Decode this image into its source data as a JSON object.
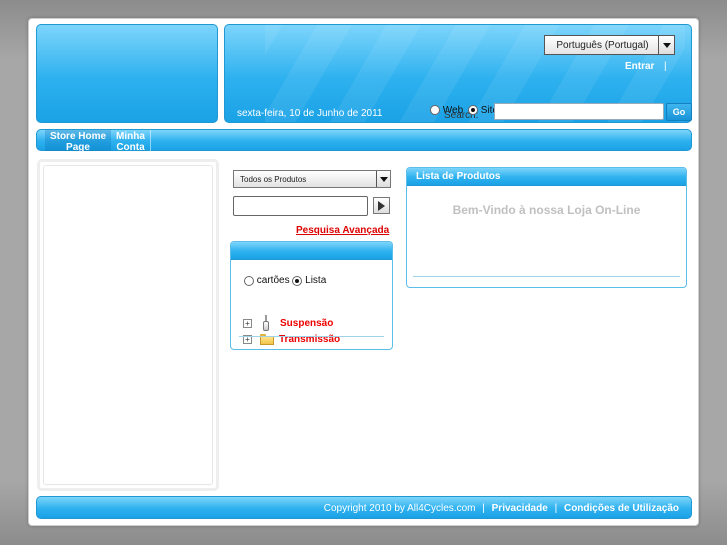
{
  "header": {
    "language": "Português (Portugal)",
    "login_label": "Entrar",
    "login_sep": "|",
    "date": "sexta-feira, 10 de Junho de 2011",
    "search": {
      "label": "Search:",
      "option_web": "Web",
      "option_site": "Site",
      "selected": "Site",
      "value": "",
      "go_label": "Go"
    }
  },
  "nav": {
    "items": [
      {
        "label": "Store Home Page"
      },
      {
        "label": "Minha Conta"
      }
    ]
  },
  "catalog": {
    "product_filter": "Todos os Produtos",
    "keyword_value": "",
    "advanced_search": "Pesquisa Avançada",
    "view_options": {
      "cards": "cartões",
      "list": "Lista",
      "selected": "Lista"
    },
    "categories": [
      {
        "label": "Suspensão",
        "icon": "shock-absorber-icon"
      },
      {
        "label": "Transmissão",
        "icon": "folder-icon"
      }
    ]
  },
  "product_list": {
    "title": "Lista de Produtos",
    "welcome": "Bem-Vindo à nossa Loja On-Line"
  },
  "footer": {
    "copyright": "Copyright 2010 by All4Cycles.com",
    "sep": "|",
    "privacy": "Privacidade",
    "terms": "Condições de Utilização"
  },
  "colors": {
    "accent_blue": "#2eb1ef",
    "link_red": "#dd0000",
    "welcome_gray": "#c0c0c0"
  }
}
